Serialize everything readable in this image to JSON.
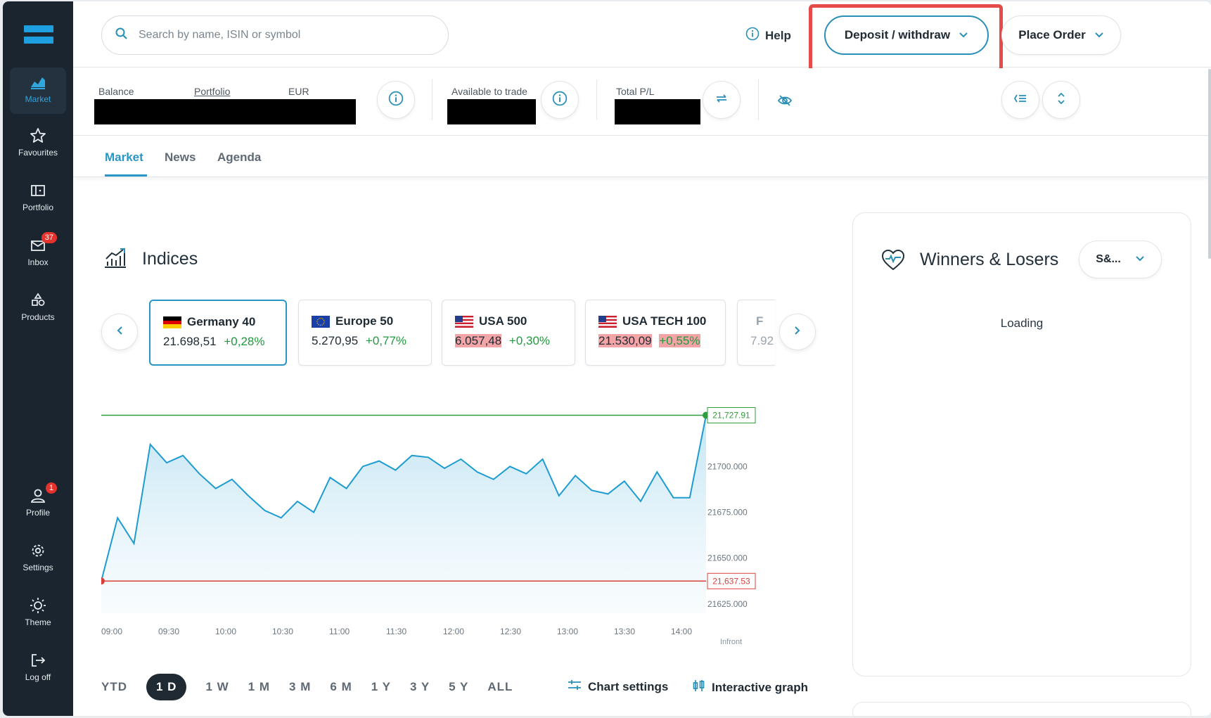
{
  "sidebar": {
    "items": [
      {
        "label": "Market",
        "icon": "market-chart-icon",
        "active": true
      },
      {
        "label": "Favourites",
        "icon": "star-icon"
      },
      {
        "label": "Portfolio",
        "icon": "portfolio-icon"
      },
      {
        "label": "Inbox",
        "icon": "inbox-icon",
        "badge": "37"
      },
      {
        "label": "Products",
        "icon": "products-icon"
      }
    ],
    "bottom_items": [
      {
        "label": "Profile",
        "icon": "profile-icon",
        "badge": "1"
      },
      {
        "label": "Settings",
        "icon": "gear-icon"
      },
      {
        "label": "Theme",
        "icon": "sun-icon"
      },
      {
        "label": "Log off",
        "icon": "logout-icon"
      }
    ]
  },
  "header": {
    "search_placeholder": "Search by name, ISIN or symbol",
    "help_label": "Help",
    "deposit_label": "Deposit / withdraw",
    "place_order_label": "Place Order"
  },
  "account": {
    "balance_label": "Balance",
    "portfolio_label": "Portfolio",
    "currency_label": "EUR",
    "available_label": "Available to trade",
    "total_pl_label": "Total P/L"
  },
  "tabs": [
    "Market",
    "News",
    "Agenda"
  ],
  "indices": {
    "title": "Indices",
    "cards": [
      {
        "name": "Germany 40",
        "price": "21.698,51",
        "change": "+0,28%"
      },
      {
        "name": "Europe 50",
        "price": "5.270,95",
        "change": "+0,77%"
      },
      {
        "name": "USA 500",
        "price": "6.057,48",
        "change": "+0,30%"
      },
      {
        "name": "USA TECH 100",
        "price": "21.530,09",
        "change": "+0,55%"
      },
      {
        "name": "F",
        "price": "7.92",
        "change": ""
      }
    ]
  },
  "chart_data": {
    "type": "area",
    "series": [
      {
        "name": "Germany 40",
        "values": [
          21637.53,
          21672,
          21658,
          21712,
          21702,
          21706,
          21696,
          21688,
          21693,
          21684,
          21676,
          21672,
          21681,
          21675,
          21694,
          21688,
          21700,
          21703,
          21698,
          21706,
          21705,
          21699,
          21704,
          21697,
          21693,
          21700,
          21696,
          21704,
          21684,
          21695,
          21687,
          21685,
          21692,
          21681,
          21697,
          21683,
          21683,
          21727.91
        ]
      }
    ],
    "x_ticks": [
      "09:00",
      "09:30",
      "10:00",
      "10:30",
      "11:00",
      "11:30",
      "12:00",
      "12:30",
      "13:00",
      "13:30",
      "14:00"
    ],
    "y_ticks": [
      "21700.000",
      "21675.000",
      "21650.000",
      "21625.000"
    ],
    "high_label": "21,727.91",
    "low_label": "21,637.53",
    "ylim": [
      21620,
      21735
    ],
    "source": "Infront",
    "accent_line": "#1e9cd0",
    "high_color": "#2e9e3c",
    "low_color": "#d9403c"
  },
  "chart_controls": {
    "periods": [
      "YTD",
      "1D",
      "1W",
      "1M",
      "3M",
      "6M",
      "1Y",
      "3Y",
      "5Y",
      "ALL"
    ],
    "period_display": [
      "YTD",
      "1 D",
      "1 W",
      "1 M",
      "3 M",
      "6 M",
      "1 Y",
      "3 Y",
      "5 Y",
      "ALL"
    ],
    "active": "1D",
    "chart_settings_label": "Chart settings",
    "interactive_graph_label": "Interactive graph"
  },
  "winners_losers": {
    "title": "Winners & Losers",
    "selected": "S&...",
    "status": "Loading"
  }
}
